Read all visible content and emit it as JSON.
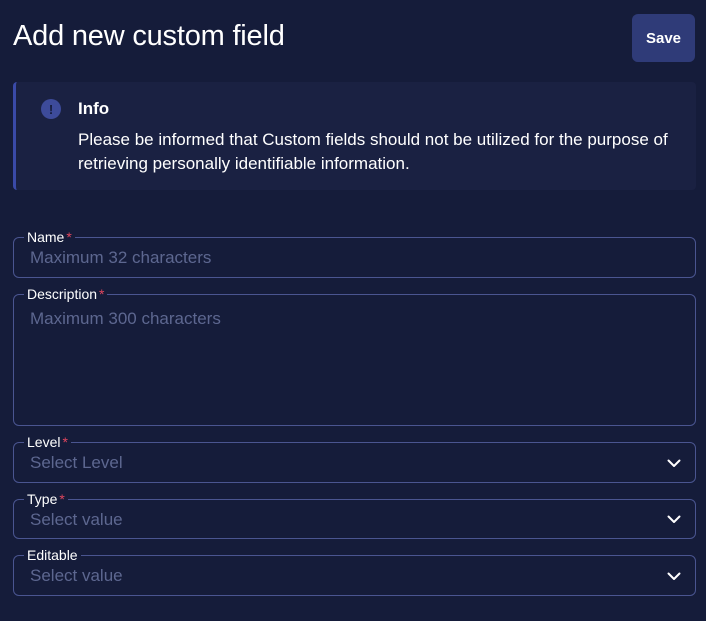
{
  "header": {
    "title": "Add new custom field",
    "save_label": "Save"
  },
  "info": {
    "icon": "exclamation-icon",
    "title": "Info",
    "text": "Please be informed that Custom fields should not be utilized for the purpose of retrieving personally identifiable information."
  },
  "form": {
    "name": {
      "label": "Name",
      "required": "*",
      "placeholder": "Maximum 32 characters"
    },
    "description": {
      "label": "Description",
      "required": "*",
      "placeholder": "Maximum 300 characters"
    },
    "level": {
      "label": "Level",
      "required": "*",
      "placeholder": "Select Level"
    },
    "type": {
      "label": "Type",
      "required": "*",
      "placeholder": "Select value"
    },
    "editable": {
      "label": "Editable",
      "placeholder": "Select value"
    }
  },
  "colors": {
    "background": "#151c3a",
    "accent": "#2f3b78",
    "required": "#e0465e",
    "border": "#4a5590"
  }
}
